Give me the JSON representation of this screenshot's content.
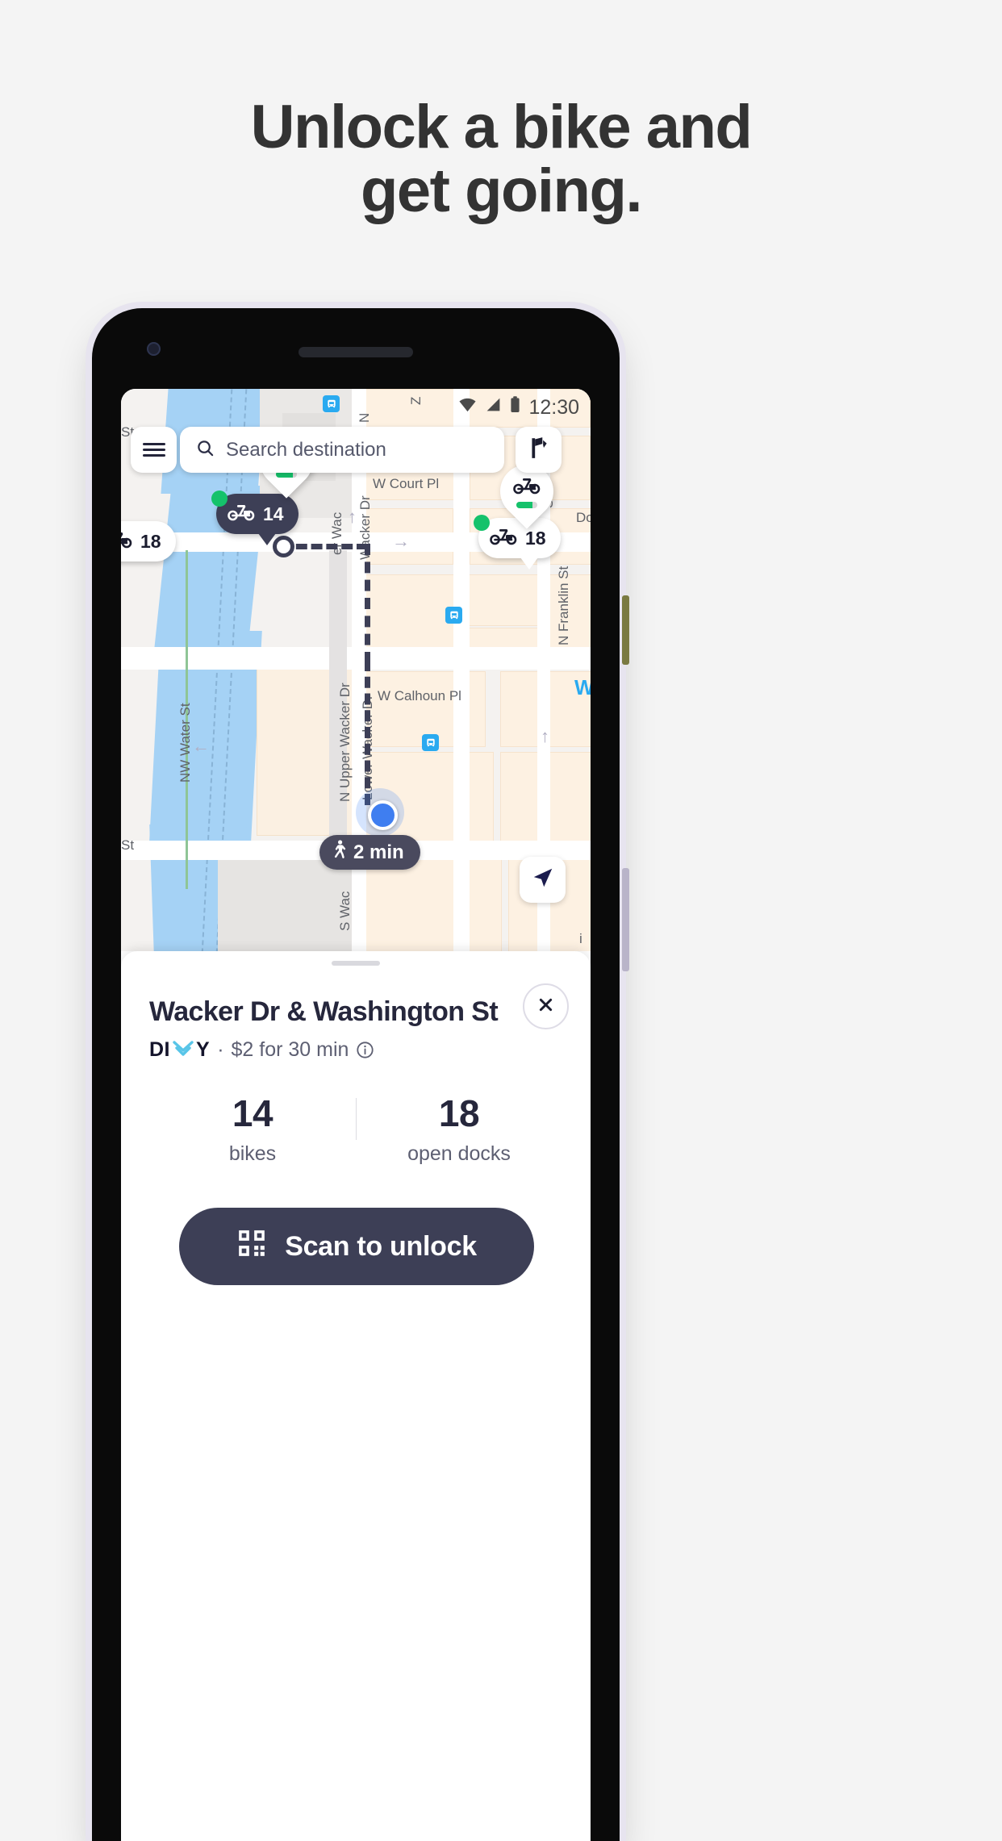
{
  "headline": {
    "line1": "Unlock a bike and",
    "line2": "get going."
  },
  "phone": {
    "status_bar": {
      "time": "12:30",
      "icons": [
        "wifi-icon",
        "cellular-signal-icon",
        "battery-icon"
      ]
    },
    "map": {
      "search": {
        "placeholder": "Search destination",
        "icon": "search-icon"
      },
      "menu_icon": "hamburger-menu-icon",
      "route_icon": "flag-route-icon",
      "locate_icon": "navigation-arrow-icon",
      "walk_badge": {
        "icon": "walking-person-icon",
        "label": "2 min"
      },
      "markers": [
        {
          "id": "selected",
          "count": "14",
          "style": "selected-dark-pill",
          "availability": "available"
        },
        {
          "id": "left-edge",
          "count": "18",
          "style": "light-pill",
          "availability": "available"
        },
        {
          "id": "right",
          "count": "18",
          "style": "light-pill",
          "availability": "available"
        },
        {
          "id": "pin-top",
          "count": "",
          "style": "teardrop-pin",
          "availability": "available"
        },
        {
          "id": "pin-right",
          "count": "",
          "style": "teardrop-pin",
          "availability": "available"
        }
      ],
      "street_labels": [
        "W Court Pl",
        "W Calhoun Pl",
        "N Franklin St",
        "NW Water St",
        "N Upper Wacker Dr",
        "Lower Wacker Dr",
        "Wacker Dr",
        "er Wac",
        "S Wac",
        "on St",
        "St",
        "St",
        "N",
        "St",
        "Z",
        "Do",
        "i",
        "W"
      ]
    },
    "sheet": {
      "station_name": "Wacker Dr & Washington St",
      "brand": "DIVY",
      "brand_letters_before": "DI",
      "brand_letters_after": "Y",
      "price_separator": "·",
      "price_text": "$2 for 30 min",
      "info_icon": "info-circle-icon",
      "close_icon": "close-x-icon",
      "stats": [
        {
          "value": "14",
          "label": "bikes"
        },
        {
          "value": "18",
          "label": "open docks"
        }
      ],
      "primary_button": {
        "label": "Scan to unlock",
        "icon": "qr-code-icon"
      }
    }
  },
  "colors": {
    "page_bg": "#f4f4f4",
    "headline": "#333333",
    "dark_navy": "#3d3f56",
    "deep_navy": "#1b1c2e",
    "green": "#15c26b",
    "blue_dot": "#3f7ef0",
    "water": "#a5d2f5",
    "land": "#fdf1e2",
    "divvy_cyan": "#58c5e8"
  }
}
